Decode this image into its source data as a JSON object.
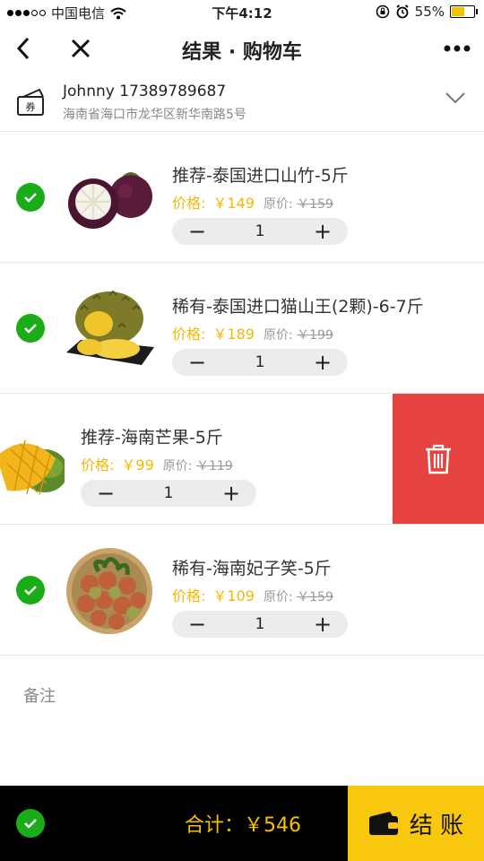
{
  "status": {
    "carrier": "中国电信",
    "time": "下午4:12",
    "battery": "55%"
  },
  "nav": {
    "title": "结果 · 购物车"
  },
  "address": {
    "ticket_label": "券",
    "contact": "Johnny 17389789687",
    "address": "海南省海口市龙华区新华南路5号"
  },
  "labels": {
    "price": "价格:",
    "orig": "原价:",
    "minus": "−",
    "plus": "+"
  },
  "items": [
    {
      "name": "推荐-泰国进口山竹-5斤",
      "price": "￥149",
      "orig": "￥159",
      "qty": "1",
      "checked": true,
      "fruit": "mangosteen-image"
    },
    {
      "name": "稀有-泰国进口猫山王(2颗)-6-7斤",
      "price": "￥189",
      "orig": "￥199",
      "qty": "1",
      "checked": true,
      "fruit": "durian-image"
    },
    {
      "name": "推荐-海南芒果-5斤",
      "price": "￥99",
      "orig": "￥119",
      "qty": "1",
      "checked": false,
      "fruit": "mango-image"
    },
    {
      "name": "稀有-海南妃子笑-5斤",
      "price": "￥109",
      "orig": "￥159",
      "qty": "1",
      "checked": true,
      "fruit": "lychee-image"
    }
  ],
  "remark": {
    "placeholder": "备注"
  },
  "footer": {
    "total": "合计：￥546",
    "checkout": "结 账"
  },
  "colors": {
    "accent": "#f5c000",
    "check": "#1aad19",
    "delete": "#e64340"
  }
}
